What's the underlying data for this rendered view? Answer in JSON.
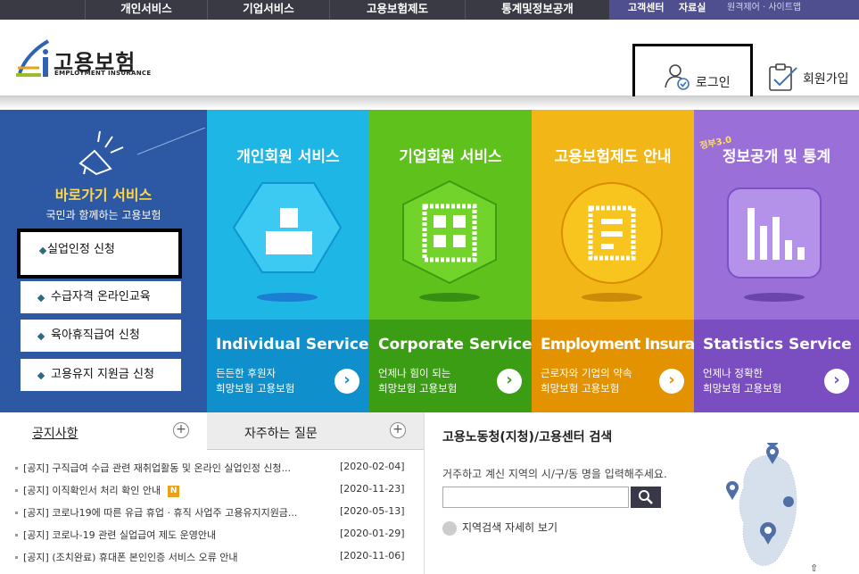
{
  "top_nav": {
    "items": [
      "개인서비스",
      "기업서비스",
      "고용보험제도",
      "통계및정보공개"
    ],
    "util": [
      "고객센터",
      "자료실",
      "원격제어 · 사이트맵"
    ]
  },
  "header": {
    "logo_title": "고용보험",
    "logo_sub": "EMPLOYMENT INSURANCE",
    "login": "로그인",
    "join": "회원가입"
  },
  "quick": {
    "title": "바로가기 서비스",
    "subtitle": "국민과 함께하는 고용보험",
    "items": [
      "실업인정 신청",
      "수급자격 온라인교육",
      "육아휴직급여 신청",
      "고용유지 지원금 신청"
    ]
  },
  "panels": [
    {
      "title": "개인회원 서비스",
      "en": "Individual Service",
      "d1": "든든한 후원자",
      "d2": "희망보험 고용보험",
      "color": "#1eb6e4",
      "dark": "#0f8fcb"
    },
    {
      "title": "기업회원 서비스",
      "en": "Corporate Service",
      "d1": "언제나 힘이 되는",
      "d2": "희망보험 고용보험",
      "color": "#5fc21c",
      "dark": "#3b9d14"
    },
    {
      "title": "고용보험제도 안내",
      "en": "Employment Insurance",
      "d1": "근로자와 기업의 약속",
      "d2": "희망보험 고용보험",
      "color": "#f2b616",
      "dark": "#e39200"
    },
    {
      "title": "정보공개 및 통계",
      "tag": "정부3.0",
      "en": "Statistics Service",
      "d1": "언제나 정확한",
      "d2": "희망보험 고용보험",
      "color": "#9b6fd8",
      "dark": "#7a4ec0"
    }
  ],
  "notice": {
    "tab_notice": "공지사항",
    "tab_faq": "자주하는 질문",
    "items": [
      {
        "text": "[공지] 구직급여 수급 관련 재취업활동 및 온라인 실업인정 신청...",
        "date": "[2020-02-04]",
        "new": false
      },
      {
        "text": "[공지] 이직확인서 처리 확인 안내",
        "date": "[2020-11-23]",
        "new": true
      },
      {
        "text": "[공지] 코로나19에 따른 유급 휴업 · 휴직 사업주 고용유지지원금...",
        "date": "[2020-05-13]",
        "new": false
      },
      {
        "text": "[공지] 코로나-19 관련 실업급여 제도 운영안내",
        "date": "[2020-01-29]",
        "new": false
      },
      {
        "text": "[공지] (조치완료) 휴대폰 본인인증 서비스 오류 안내",
        "date": "[2020-11-06]",
        "new": false
      }
    ],
    "new_label": "N"
  },
  "search": {
    "title": "고용노동청(지청)/고용센터 검색",
    "desc": "거주하고 계신 지역의 시/구/동 명을 입력해주세요.",
    "input_value": "",
    "more": "지역검색 자세히 보기"
  }
}
